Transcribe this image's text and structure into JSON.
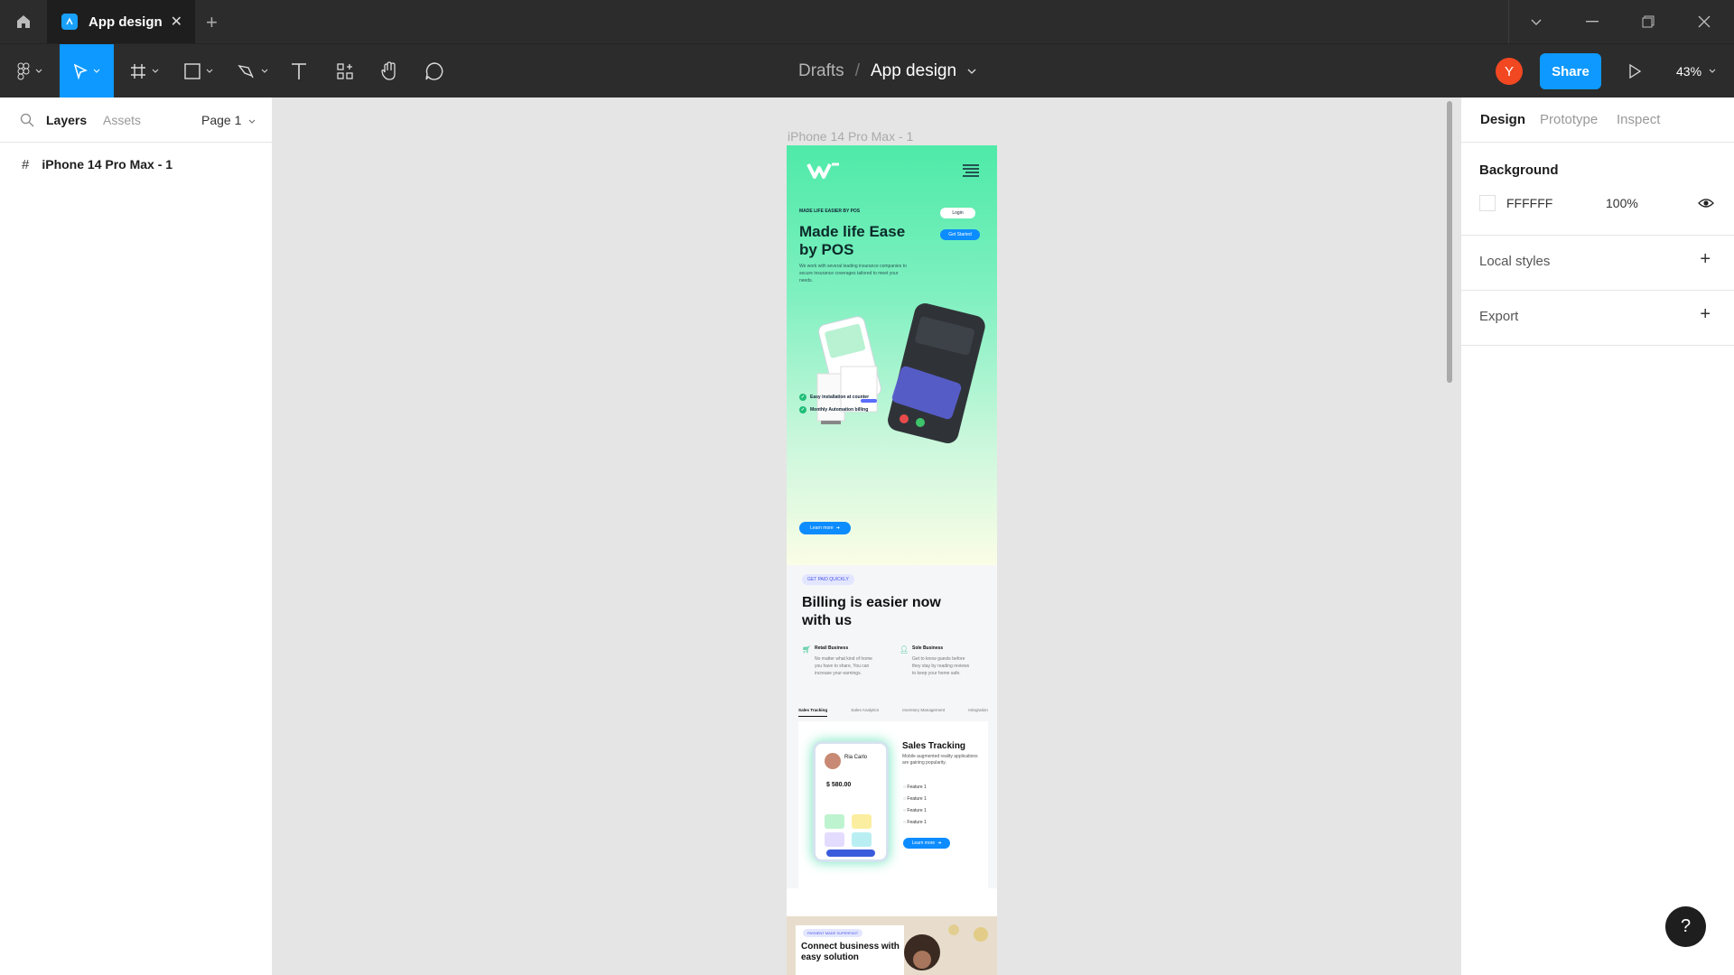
{
  "tabbar": {
    "file_tab_title": "App design",
    "close_glyph": "✕",
    "new_tab_glyph": "+"
  },
  "toolbar": {
    "crumb_parent": "Drafts",
    "crumb_sep": "/",
    "crumb_current": "App design",
    "avatar_initial": "Y",
    "share_label": "Share",
    "zoom": "43%",
    "active_tool": "move"
  },
  "left_panel": {
    "tab_layers": "Layers",
    "tab_assets": "Assets",
    "page_selector": "Page 1",
    "layers": [
      {
        "icon": "frame-grid-icon",
        "name": "iPhone 14 Pro Max - 1"
      }
    ]
  },
  "canvas": {
    "frame_label": "iPhone 14 Pro Max - 1",
    "hero": {
      "kicker": "MADE LIFE EASIER BY POS",
      "headline": "Made life Ease by POS",
      "desc": "We work with several leading insurance companies to secure insurance coverages tailored to meet your needs.",
      "login": "Login",
      "get_started": "Get Started",
      "checks": [
        "Easy installation at counter",
        "Monthly Automation billing"
      ],
      "learn_more": "Learn more"
    },
    "billing": {
      "pill": "GET PAID QUICKLY",
      "heading": "Billing is easier now with us",
      "features": [
        {
          "title": "Retail Business",
          "desc": "No matter what kind of home you have to share, You can increase your earnings."
        },
        {
          "title": "Sole Business",
          "desc": "Get to know guests before they stay by reading reviews to keep your home safe."
        }
      ],
      "tabs": [
        "Sales Tracking",
        "Sales Analytics",
        "Inventory Management",
        "Integration"
      ],
      "card_title": "Sales Tracking",
      "card_sub": "Mobile augmented reality applications are gaining popularity.",
      "card_features": [
        "Feature 1",
        "Feature 1",
        "Feature 1",
        "Feature 1"
      ],
      "card_learn": "Learn more",
      "phone_name": "Ria Carlo",
      "phone_amount": "$ 580.00"
    },
    "connect": {
      "pill": "PAYMENT MADE SUPERFAST",
      "heading": "Connect business with easy solution"
    }
  },
  "right_panel": {
    "tabs": [
      "Design",
      "Prototype",
      "Inspect"
    ],
    "background_title": "Background",
    "bg_hex": "FFFFFF",
    "bg_opacity": "100%",
    "local_styles": "Local styles",
    "export": "Export"
  },
  "help_label": "?",
  "colors": {
    "accent": "#0d99ff",
    "avatar": "#f24822",
    "chrome": "#2c2c2c"
  }
}
